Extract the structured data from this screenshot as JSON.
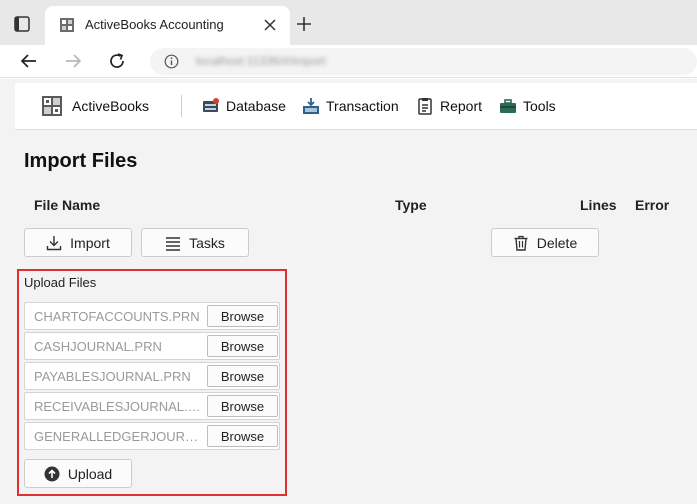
{
  "browser": {
    "tab_title": "ActiveBooks Accounting",
    "url": "localhost:11336/#/import",
    "icons": [
      "window-icon",
      "app-favicon-icon",
      "close-icon",
      "plus-icon",
      "back-arrow-icon",
      "forward-arrow-icon",
      "refresh-icon",
      "info-icon"
    ]
  },
  "navbar": {
    "brand": "ActiveBooks",
    "menu": [
      {
        "label": "Database",
        "icon": "database-icon"
      },
      {
        "label": "Transaction",
        "icon": "transaction-icon"
      },
      {
        "label": "Report",
        "icon": "report-icon"
      },
      {
        "label": "Tools",
        "icon": "toolbox-icon"
      }
    ]
  },
  "page": {
    "title": "Import Files",
    "columns": [
      "File Name",
      "Type",
      "Lines",
      "Error"
    ],
    "buttons": {
      "import": "Import",
      "tasks": "Tasks",
      "delete": "Delete"
    }
  },
  "upload": {
    "title": "Upload Files",
    "files": [
      {
        "name": "CHARTOFACCOUNTS.PRN",
        "browse": "Browse"
      },
      {
        "name": "CASHJOURNAL.PRN",
        "browse": "Browse"
      },
      {
        "name": "PAYABLESJOURNAL.PRN",
        "browse": "Browse"
      },
      {
        "name": "RECEIVABLESJOURNAL.P...",
        "browse": "Browse"
      },
      {
        "name": "GENERALLEDGERJOURN...",
        "browse": "Browse"
      }
    ],
    "upload_label": "Upload"
  },
  "colors": {
    "highlight_border": "#e03030",
    "background": "#f3f3f3",
    "tab_strip": "#e8e8e8"
  }
}
